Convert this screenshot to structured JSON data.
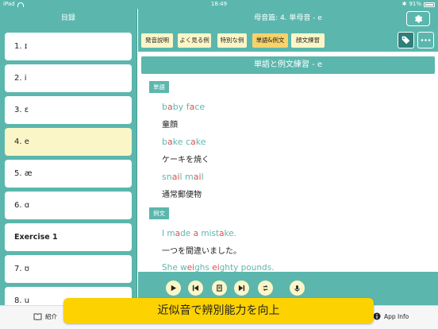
{
  "status_bar": {
    "left_label": "iPad",
    "time": "18:49",
    "battery_text": "91%"
  },
  "sidebar": {
    "title": "目録",
    "items": [
      {
        "label": "1. ɪ"
      },
      {
        "label": "2. i"
      },
      {
        "label": "3. ɛ"
      },
      {
        "label": "4. e"
      },
      {
        "label": "5. æ"
      },
      {
        "label": "6. ɑ"
      },
      {
        "label": "Exercise 1"
      },
      {
        "label": "7. ʊ"
      },
      {
        "label": "8. u"
      }
    ]
  },
  "header": {
    "title": "母音篇: 4. 単母音 - e"
  },
  "tabs": [
    {
      "label": "発音説明"
    },
    {
      "label": "よく見る例"
    },
    {
      "label": "特別な例"
    },
    {
      "label": "単語&例文"
    },
    {
      "label": "顔文練習"
    }
  ],
  "content": {
    "title": "単語と例文練習 - e",
    "words_label": "単語",
    "words": [
      {
        "parts": [
          "b",
          "a",
          "by f",
          "a",
          "ce"
        ],
        "translation": "童顔"
      },
      {
        "parts": [
          "b",
          "a",
          "ke c",
          "a",
          "ke"
        ],
        "translation": "ケーキを焼く"
      },
      {
        "parts": [
          "sn",
          "ai",
          "l m",
          "ai",
          "l"
        ],
        "translation": "通常郵便物"
      }
    ],
    "sentences_label": "例文",
    "sentences": [
      {
        "parts": [
          "I m",
          "a",
          "de ",
          "a",
          " mist",
          "a",
          "ke."
        ],
        "translation": "一つを間違いました。"
      },
      {
        "parts": [
          "She w",
          "ei",
          "ghs ",
          "ei",
          "ghty pounds."
        ],
        "translation": ""
      }
    ]
  },
  "player_icons": [
    "play-icon",
    "previous-icon",
    "transcript-icon",
    "next-icon",
    "repeat-icon",
    "microphone-icon"
  ],
  "bottom_bar": {
    "intro_label": "紹介",
    "app_info_label": "App Info"
  },
  "banner": {
    "text": "近似音で辨別能力を向上"
  },
  "colors": {
    "teal": "#5bb7ad",
    "highlight": "#d9534f",
    "cream": "#fbf6c8",
    "active_tab": "#f8d26a",
    "banner": "#fcd200"
  }
}
